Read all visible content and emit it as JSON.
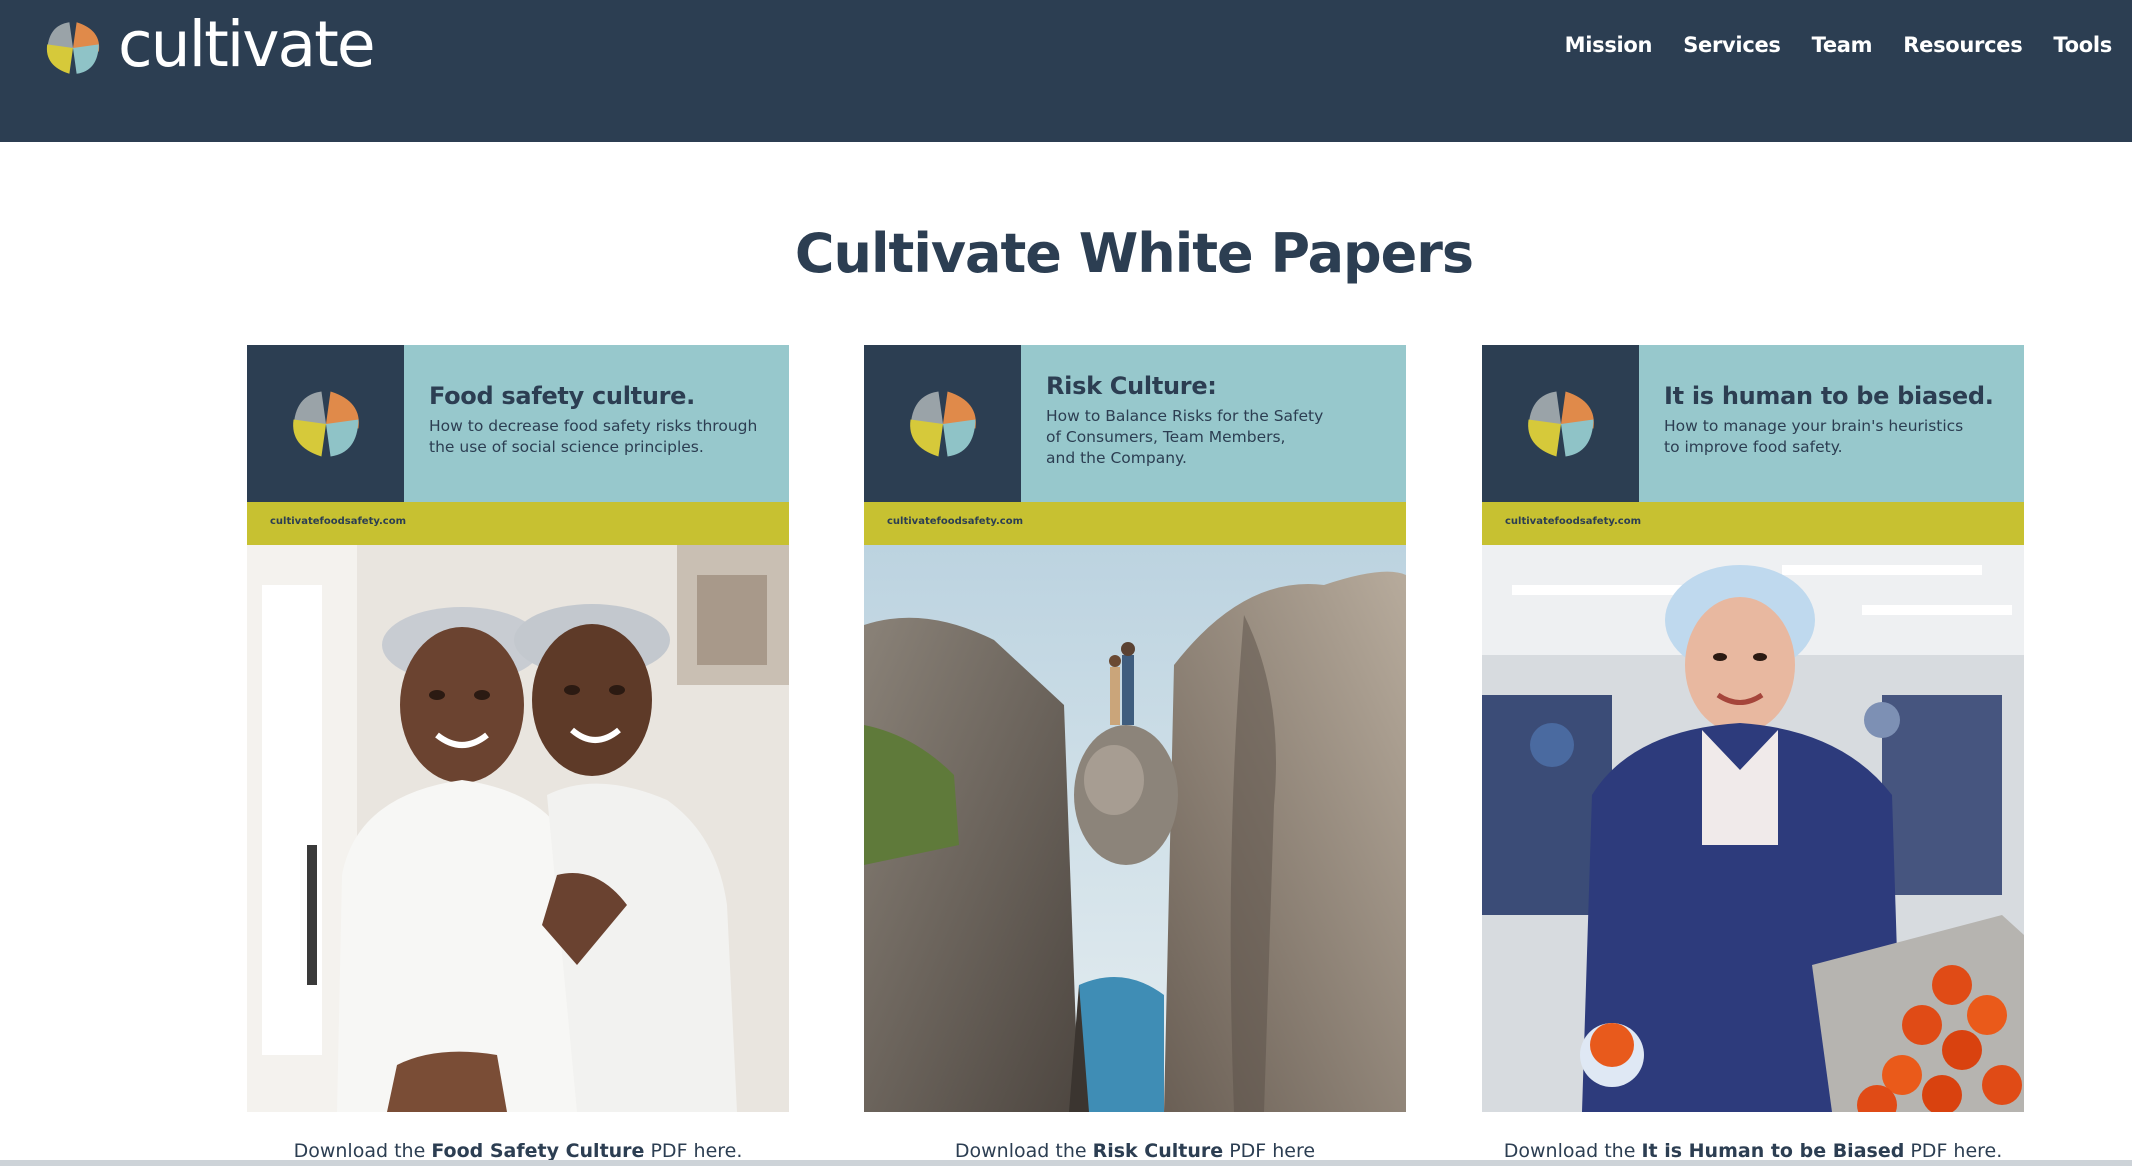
{
  "colors": {
    "navy": "#2c3e52",
    "teal": "#97c8cc",
    "olive": "#c7c131",
    "logo_orange": "#e08a4a",
    "logo_yellow": "#d6c93a",
    "logo_teal": "#8fc3c7",
    "logo_grey": "#9aa3a8"
  },
  "header": {
    "brand_name": "cultivate",
    "nav": [
      {
        "label": "Mission"
      },
      {
        "label": "Services"
      },
      {
        "label": "Team"
      },
      {
        "label": "Resources"
      },
      {
        "label": "Tools"
      }
    ]
  },
  "page": {
    "title": "Cultivate White Papers"
  },
  "papers": [
    {
      "cover_title": "Food safety culture.",
      "cover_subtitle": "How to decrease food safety risks through\nthe use of social science principles.",
      "cover_url": "cultivatefoodsafety.com",
      "photo_icon": "two-workers-smiling-photo",
      "download_prefix": "Download the ",
      "download_bold": "Food Safety Culture",
      "download_suffix": " PDF here."
    },
    {
      "cover_title": "Risk Culture:",
      "cover_subtitle": "How to Balance Risks for the Safety\nof Consumers, Team Members,\nand the Company.",
      "cover_url": "cultivatefoodsafety.com",
      "photo_icon": "cliff-boulder-photo",
      "download_prefix": "Download the ",
      "download_bold": "Risk Culture",
      "download_suffix": " PDF here"
    },
    {
      "cover_title": "It is human to be biased.",
      "cover_subtitle": "How to manage your brain's heuristics\nto improve food safety.",
      "cover_url": "cultivatefoodsafety.com",
      "photo_icon": "worker-holding-tomato-photo",
      "download_prefix": "Download the ",
      "download_bold": "It is Human to be Biased",
      "download_suffix": " PDF here."
    }
  ]
}
